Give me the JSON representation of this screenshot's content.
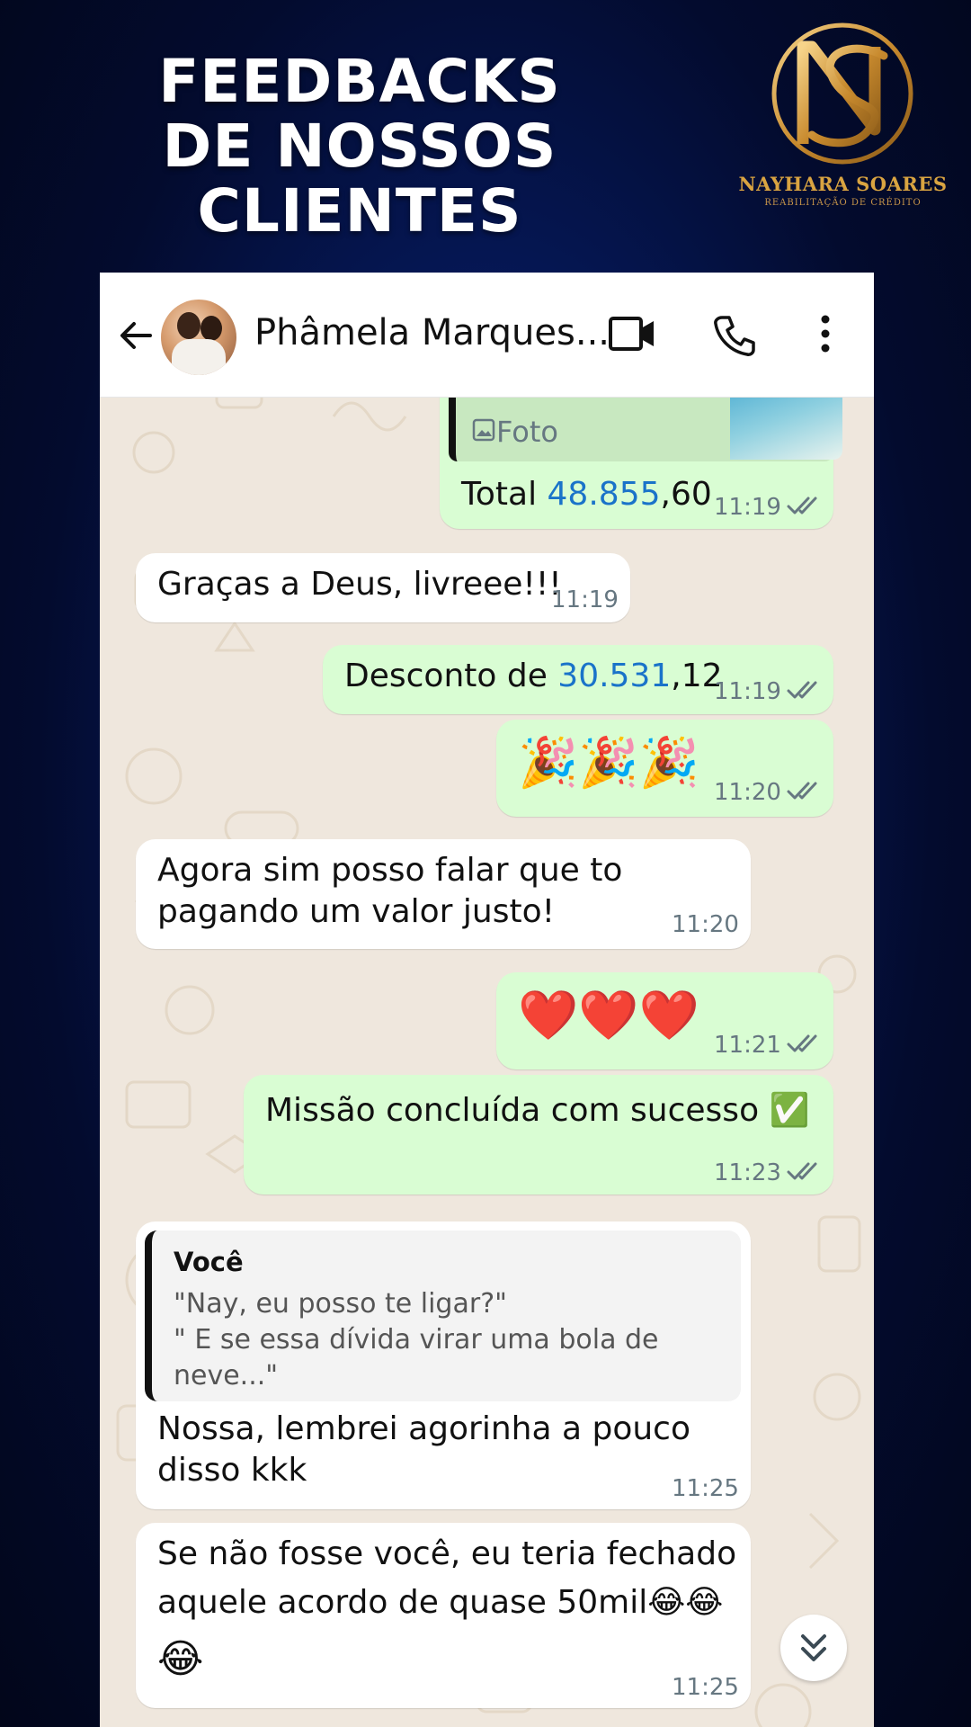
{
  "banner": {
    "headline_line1": "FEEDBACKS",
    "headline_line2": "DE NOSSOS CLIENTES",
    "brand_name": "NAYHARA SOARES",
    "brand_tagline": "REABILITAÇÃO DE CRÉDITO",
    "brand_color": "#d9a441"
  },
  "chat_header": {
    "contact_name": "Phâmela Marques..."
  },
  "messages": [
    {
      "dir": "out",
      "media_label": "Foto",
      "text_pre": "Total ",
      "text_num": "48.855",
      "text_post": ",60",
      "time": "11:19",
      "read": true
    },
    {
      "dir": "in",
      "text": "Graças a Deus, livreee!!!",
      "time": "11:19"
    },
    {
      "dir": "out",
      "text_pre": "Desconto de ",
      "text_num": "30.531",
      "text_post": ",12",
      "time": "11:19",
      "read": true
    },
    {
      "dir": "out",
      "text": "🎉🎉🎉",
      "time": "11:20",
      "read": true
    },
    {
      "dir": "in",
      "line1": "Agora sim posso falar que to",
      "line2": "pagando um valor justo!",
      "time": "11:20"
    },
    {
      "dir": "out",
      "text": "❤️❤️❤️",
      "time": "11:21",
      "read": true
    },
    {
      "dir": "out",
      "text": "Missão concluída com sucesso ✅",
      "time": "11:23",
      "read": true
    },
    {
      "dir": "in",
      "quote_author": "Você",
      "quote_text": "\"Nay, eu posso te ligar?\"\n\" E se essa dívida virar uma bola de\nneve...\"",
      "line1": "Nossa, lembrei agorinha a pouco",
      "line2": "disso kkk",
      "time": "11:25"
    },
    {
      "dir": "in",
      "line1": "Se não fosse você, eu teria fechado",
      "line2": "aquele acordo de quase 50mil😂😂",
      "line3": "😂",
      "time": "11:25"
    }
  ],
  "colors": {
    "incoming_bubble": "#ffffff",
    "outgoing_bubble": "#d9fdd3",
    "chat_background": "#efe7dd",
    "link_number": "#1a73c9",
    "read_ticks": "#667781"
  },
  "icons": [
    "back-arrow-icon",
    "video-call-icon",
    "phone-call-icon",
    "more-options-icon",
    "image-icon",
    "double-check-icon",
    "chevrons-down-icon"
  ]
}
